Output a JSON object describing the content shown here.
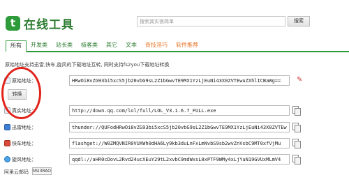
{
  "header": {
    "logo_glyph": "t",
    "logo_text": "在线工具",
    "search_placeholder": "搜索其实很简单",
    "search_button": "搜索"
  },
  "nav": {
    "tabs": [
      {
        "label": "所有"
      },
      {
        "label": "开发类"
      },
      {
        "label": "站长类"
      },
      {
        "label": "极客类"
      },
      {
        "label": "其它"
      },
      {
        "label": "文本"
      },
      {
        "label": "奇技淫巧"
      },
      {
        "label": "软件推荐"
      }
    ]
  },
  "intro": "原始地址支持迅雷,快车,旋风的下载地址互转, 同时支持fs2you下载地址转换",
  "rows": {
    "original": {
      "label": "原始地址：",
      "value": "HRwOi8vZG93bi5xcS5jb20vbG9sL2Z1bGwvTE9MX1YzLjEuNi43X0ZVTEwuZXhlICBaWg=="
    },
    "real": {
      "label": "真实地址：",
      "value": "http://down.qq.com/lol/full/LOL_V3.1.6.7_FULL.exe"
    },
    "thunder": {
      "label": "迅雷地址：",
      "value": "thunder://QUFodHRwOi8vZG93bi5xcS5jb20vbG9sL2Z1bGwvTE9MX1YzLjEuNi43X0ZVTEw"
    },
    "flashget": {
      "label": "快车地址：",
      "value": "flashget://W0ZMQVNIR0VUXWh0dHA6Ly9kb3duLnFxLmNvbS9sb2wvZnVsbC9MT0xfVjMu"
    },
    "qqdl": {
      "label": "旋风地址：",
      "value": "qqdl://aHR0cDovL2Rvd24ucXEuY29tL2xvbC9mdWxsL0xPTF9WMy4xLjYuN19GVUxMLmV4"
    }
  },
  "convert_button": "转换",
  "ali": {
    "label": "阿里云邮码",
    "code": "MU3RAO"
  },
  "colors": {
    "brand": "#2e9b3a",
    "annotation": "#e2231a",
    "tab_highlight": "#e8752a"
  }
}
